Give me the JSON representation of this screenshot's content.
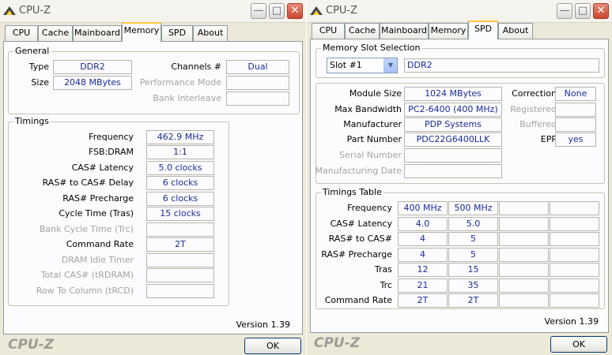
{
  "window1": {
    "title": "CPU-Z",
    "tabs": [
      "CPU",
      "Cache",
      "Mainboard",
      "Memory",
      "SPD",
      "About"
    ],
    "active_tab": "Memory",
    "general": {
      "title": "General",
      "type_label": "Type",
      "type_value": "DDR2",
      "size_label": "Size",
      "size_value": "2048 MBytes",
      "channels_label": "Channels #",
      "channels_value": "Dual",
      "perf_mode_label": "Performance Mode",
      "perf_mode_value": "",
      "bank_interleave_label": "Bank Interleave",
      "bank_interleave_value": ""
    },
    "timings": {
      "title": "Timings",
      "rows": [
        {
          "label": "Frequency",
          "value": "462.9 MHz",
          "enabled": true
        },
        {
          "label": "FSB:DRAM",
          "value": "1:1",
          "enabled": true
        },
        {
          "label": "CAS# Latency",
          "value": "5.0 clocks",
          "enabled": true
        },
        {
          "label": "RAS# to CAS# Delay",
          "value": "6 clocks",
          "enabled": true
        },
        {
          "label": "RAS# Precharge",
          "value": "6 clocks",
          "enabled": true
        },
        {
          "label": "Cycle Time (Tras)",
          "value": "15 clocks",
          "enabled": true
        },
        {
          "label": "Bank Cycle Time (Trc)",
          "value": "",
          "enabled": false
        },
        {
          "label": "Command Rate",
          "value": "2T",
          "enabled": true
        },
        {
          "label": "DRAM Idle Timer",
          "value": "",
          "enabled": false
        },
        {
          "label": "Total CAS# (tRDRAM)",
          "value": "",
          "enabled": false
        },
        {
          "label": "Row To Column (tRCD)",
          "value": "",
          "enabled": false
        }
      ]
    },
    "version": "Version 1.39",
    "brand": "CPU-Z",
    "ok_label": "OK"
  },
  "window2": {
    "title": "CPU-Z",
    "tabs": [
      "CPU",
      "Cache",
      "Mainboard",
      "Memory",
      "SPD",
      "About"
    ],
    "active_tab": "SPD",
    "slot_section": {
      "title": "Memory Slot Selection",
      "slot_selected": "Slot #1",
      "slot_type": "DDR2"
    },
    "module": {
      "module_size_label": "Module Size",
      "module_size_value": "1024 MBytes",
      "max_bandwidth_label": "Max Bandwidth",
      "max_bandwidth_value": "PC2-6400 (400 MHz)",
      "manufacturer_label": "Manufacturer",
      "manufacturer_value": "PDP Systems",
      "part_number_label": "Part Number",
      "part_number_value": "PDC22G6400LLK",
      "serial_number_label": "Serial Number",
      "serial_number_value": "",
      "mfg_date_label": "Manufacturing Date",
      "mfg_date_value": "",
      "correction_label": "Correction",
      "correction_value": "None",
      "registered_label": "Registered",
      "registered_value": "",
      "buffered_label": "Buffered",
      "buffered_value": "",
      "epp_label": "EPP",
      "epp_value": "yes"
    },
    "timings_table": {
      "title": "Timings Table",
      "rows": [
        {
          "label": "Frequency",
          "values": [
            "400 MHz",
            "500 MHz",
            "",
            ""
          ]
        },
        {
          "label": "CAS# Latency",
          "values": [
            "4.0",
            "5.0",
            "",
            ""
          ]
        },
        {
          "label": "RAS# to CAS#",
          "values": [
            "4",
            "5",
            "",
            ""
          ]
        },
        {
          "label": "RAS# Precharge",
          "values": [
            "4",
            "5",
            "",
            ""
          ]
        },
        {
          "label": "Tras",
          "values": [
            "12",
            "15",
            "",
            ""
          ]
        },
        {
          "label": "Trc",
          "values": [
            "21",
            "35",
            "",
            ""
          ]
        },
        {
          "label": "Command Rate",
          "values": [
            "2T",
            "2T",
            "",
            ""
          ]
        }
      ]
    },
    "version": "Version 1.39",
    "brand": "CPU-Z",
    "ok_label": "OK"
  }
}
